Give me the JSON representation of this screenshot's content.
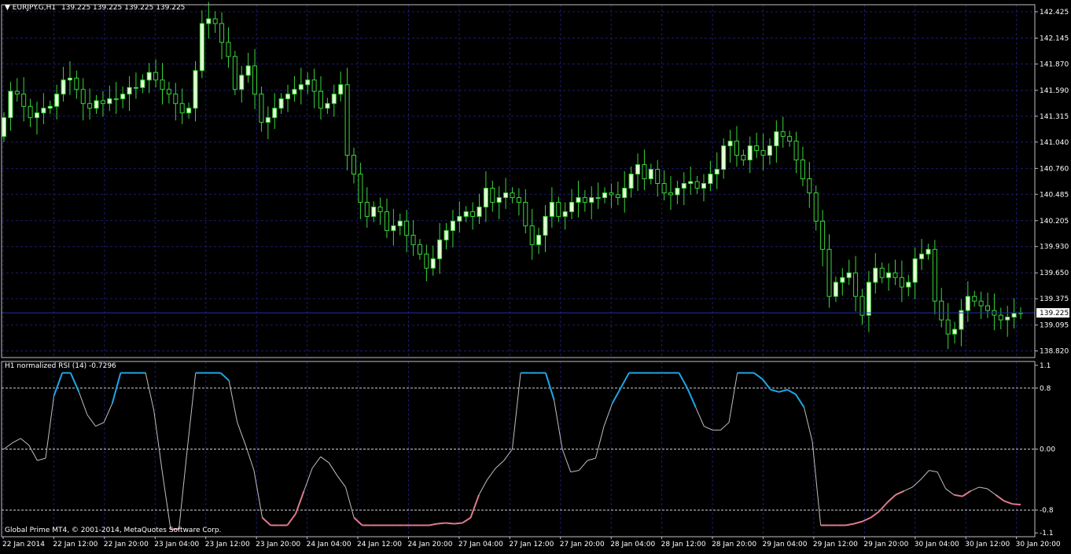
{
  "symbol_header": {
    "arrow": "▼",
    "symbol": "EURJPY.G,H1",
    "ohlc": "139.225 139.225 139.225 139.225"
  },
  "indicator_header": {
    "label": "H1 normalized RSI (14) -0.7296"
  },
  "copyright": "Global Prime MT4, © 2001-2014, MetaQuotes Software Corp.",
  "colors": {
    "background": "#000000",
    "grid": "#1c1c6e",
    "bull_body": "#e8ffd8",
    "bear_body": "#000000",
    "wick": "#39d639",
    "price_line": "#1f2fa8",
    "rsi_line": "#bfbfbf",
    "rsi_overbought": "#1ea7e8",
    "rsi_oversold": "#e07a8d",
    "level_lines": "#cfcfcf",
    "axis_text": "#ffffff"
  },
  "chart_data": [
    {
      "type": "candlestick",
      "title": "EURJPY.G,H1",
      "current_price": 139.225,
      "current_price_label": "139.225",
      "ylim": [
        138.75,
        142.5
      ],
      "y_ticks": [
        "142.425",
        "142.145",
        "141.870",
        "141.590",
        "141.315",
        "141.040",
        "140.760",
        "140.485",
        "140.205",
        "139.930",
        "139.650",
        "139.375",
        "139.095",
        "138.820"
      ],
      "x_ticks": [
        "22 Jan 2014",
        "22 Jan 12:00",
        "22 Jan 20:00",
        "23 Jan 04:00",
        "23 Jan 12:00",
        "23 Jan 20:00",
        "24 Jan 04:00",
        "24 Jan 12:00",
        "24 Jan 20:00",
        "27 Jan 04:00",
        "27 Jan 12:00",
        "27 Jan 20:00",
        "28 Jan 04:00",
        "28 Jan 12:00",
        "28 Jan 20:00",
        "29 Jan 04:00",
        "29 Jan 12:00",
        "29 Jan 20:00",
        "30 Jan 04:00",
        "30 Jan 12:00",
        "30 Jan 20:00"
      ],
      "grid": true,
      "close": [
        141.3,
        141.58,
        141.55,
        141.42,
        141.3,
        141.35,
        141.4,
        141.42,
        141.55,
        141.7,
        141.72,
        141.6,
        141.45,
        141.4,
        141.48,
        141.45,
        141.5,
        141.5,
        141.55,
        141.62,
        141.62,
        141.7,
        141.78,
        141.7,
        141.6,
        141.55,
        141.45,
        141.35,
        141.4,
        141.8,
        142.3,
        142.35,
        142.3,
        142.1,
        141.95,
        141.6,
        141.75,
        141.85,
        141.55,
        141.25,
        141.3,
        141.4,
        141.5,
        141.55,
        141.6,
        141.65,
        141.7,
        141.58,
        141.4,
        141.45,
        141.55,
        141.65,
        140.9,
        140.7,
        140.4,
        140.25,
        140.35,
        140.3,
        140.1,
        140.15,
        140.2,
        140.05,
        139.95,
        139.85,
        139.7,
        139.8,
        140.0,
        140.1,
        140.2,
        140.25,
        140.3,
        140.25,
        140.35,
        140.55,
        140.4,
        140.45,
        140.5,
        140.45,
        140.4,
        140.15,
        139.95,
        140.05,
        140.25,
        140.4,
        140.25,
        140.3,
        140.4,
        140.45,
        140.4,
        140.45,
        140.45,
        140.5,
        140.48,
        140.45,
        140.55,
        140.7,
        140.8,
        140.65,
        140.75,
        140.6,
        140.5,
        140.48,
        140.55,
        140.6,
        140.62,
        140.55,
        140.6,
        140.7,
        140.75,
        141.0,
        141.05,
        140.9,
        140.85,
        141.0,
        140.95,
        140.9,
        141.0,
        141.15,
        141.1,
        141.05,
        140.85,
        140.65,
        140.5,
        140.2,
        139.9,
        139.4,
        139.55,
        139.6,
        139.65,
        139.4,
        139.2,
        139.55,
        139.7,
        139.6,
        139.65,
        139.6,
        139.5,
        139.55,
        139.8,
        139.85,
        139.9,
        139.35,
        139.15,
        139.0,
        139.05,
        139.25,
        139.4,
        139.35,
        139.3,
        139.25,
        139.2,
        139.15,
        139.18,
        139.22,
        139.225
      ],
      "open": [
        141.1,
        141.3,
        141.58,
        141.55,
        141.42,
        141.3,
        141.35,
        141.4,
        141.42,
        141.55,
        141.7,
        141.72,
        141.6,
        141.45,
        141.4,
        141.48,
        141.45,
        141.5,
        141.5,
        141.55,
        141.62,
        141.62,
        141.7,
        141.78,
        141.7,
        141.6,
        141.55,
        141.45,
        141.35,
        141.4,
        141.8,
        142.3,
        142.35,
        142.3,
        142.1,
        141.95,
        141.6,
        141.75,
        141.85,
        141.55,
        141.25,
        141.3,
        141.4,
        141.5,
        141.55,
        141.6,
        141.65,
        141.7,
        141.58,
        141.4,
        141.45,
        141.55,
        141.65,
        140.9,
        140.7,
        140.4,
        140.25,
        140.35,
        140.3,
        140.1,
        140.15,
        140.2,
        140.05,
        139.95,
        139.85,
        139.7,
        139.8,
        140.0,
        140.1,
        140.2,
        140.25,
        140.3,
        140.25,
        140.35,
        140.55,
        140.4,
        140.45,
        140.5,
        140.45,
        140.4,
        140.15,
        139.95,
        140.05,
        140.25,
        140.4,
        140.25,
        140.3,
        140.4,
        140.45,
        140.4,
        140.45,
        140.45,
        140.5,
        140.48,
        140.45,
        140.55,
        140.7,
        140.8,
        140.65,
        140.75,
        140.6,
        140.5,
        140.48,
        140.55,
        140.6,
        140.62,
        140.55,
        140.6,
        140.7,
        140.75,
        141.0,
        141.05,
        140.9,
        140.85,
        141.0,
        140.95,
        140.9,
        141.0,
        141.15,
        141.1,
        141.05,
        140.85,
        140.65,
        140.5,
        140.2,
        139.9,
        139.4,
        139.55,
        139.6,
        139.65,
        139.4,
        139.2,
        139.55,
        139.7,
        139.6,
        139.65,
        139.6,
        139.5,
        139.55,
        139.8,
        139.85,
        139.9,
        139.35,
        139.15,
        139.0,
        139.05,
        139.25,
        139.4,
        139.35,
        139.3,
        139.25,
        139.2,
        139.15,
        139.18,
        139.22
      ]
    },
    {
      "type": "line",
      "title": "H1 normalized RSI (14) -0.7296",
      "ylim": [
        -1.15,
        1.15
      ],
      "y_ticks": [
        "1.1",
        "0.8",
        "0.00",
        "-0.8",
        "-1.1"
      ],
      "levels": [
        0.8,
        0.0,
        -0.8
      ],
      "values": [
        0.0,
        0.08,
        0.14,
        0.05,
        -0.15,
        -0.12,
        0.7,
        1.0,
        1.0,
        0.75,
        0.45,
        0.3,
        0.35,
        0.6,
        1.0,
        1.0,
        1.0,
        1.0,
        0.5,
        -0.3,
        -1.05,
        -1.05,
        0.0,
        1.0,
        1.0,
        1.0,
        1.0,
        0.9,
        0.35,
        0.05,
        -0.28,
        -0.9,
        -1.0,
        -1.0,
        -1.0,
        -0.85,
        -0.55,
        -0.25,
        -0.1,
        -0.18,
        -0.35,
        -0.5,
        -0.9,
        -1.0,
        -1.0,
        -1.0,
        -1.0,
        -1.0,
        -1.0,
        -1.0,
        -1.0,
        -1.0,
        -0.98,
        -0.97,
        -0.98,
        -0.97,
        -0.9,
        -0.6,
        -0.4,
        -0.25,
        -0.15,
        0.0,
        1.0,
        1.0,
        1.0,
        1.0,
        0.65,
        0.0,
        -0.3,
        -0.28,
        -0.15,
        -0.12,
        0.3,
        0.6,
        0.8,
        1.0,
        1.0,
        1.0,
        1.0,
        1.0,
        1.0,
        1.0,
        0.8,
        0.55,
        0.3,
        0.25,
        0.25,
        0.35,
        1.0,
        1.0,
        1.0,
        0.92,
        0.78,
        0.75,
        0.78,
        0.72,
        0.55,
        0.1,
        -1.0,
        -1.0,
        -1.0,
        -1.0,
        -0.98,
        -0.95,
        -0.9,
        -0.82,
        -0.7,
        -0.6,
        -0.55,
        -0.5,
        -0.4,
        -0.28,
        -0.3,
        -0.52,
        -0.6,
        -0.62,
        -0.55,
        -0.5,
        -0.52,
        -0.6,
        -0.68,
        -0.72,
        -0.73
      ]
    }
  ]
}
